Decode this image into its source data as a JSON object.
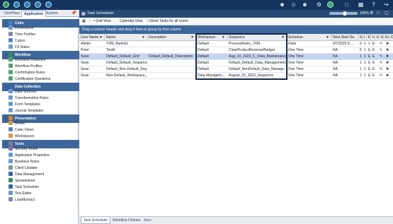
{
  "left_tabs": [
    "OnePlace",
    "Application",
    "System"
  ],
  "tree": [
    {
      "label": "Cube",
      "group": true
    },
    {
      "label": "Dimensions"
    },
    {
      "label": "Time Profiles"
    },
    {
      "label": "Cubes"
    },
    {
      "label": "FX Rates"
    },
    {
      "label": "Workflow",
      "group": true
    },
    {
      "label": "Workflow Channels"
    },
    {
      "label": "Workflow Profiles"
    },
    {
      "label": "Confirmation Rules"
    },
    {
      "label": "Certification Questions"
    },
    {
      "label": "Data Collection",
      "group": true
    },
    {
      "label": "Data Sources"
    },
    {
      "label": "Transformation Rules"
    },
    {
      "label": "Form Templates"
    },
    {
      "label": "Journal Templates"
    },
    {
      "label": "Presentation",
      "group": true
    },
    {
      "label": "Books"
    },
    {
      "label": "Cube Views"
    },
    {
      "label": "Workspaces"
    },
    {
      "label": "Tools",
      "group": true
    },
    {
      "label": "Security Roles"
    },
    {
      "label": "Application Properties"
    },
    {
      "label": "Business Rules"
    },
    {
      "label": "Client Updater"
    },
    {
      "label": "Data Management"
    },
    {
      "label": "Spreadsheet"
    },
    {
      "label": "Task Scheduler"
    },
    {
      "label": "Text Editor"
    },
    {
      "label": "Load/Extract"
    }
  ],
  "panel_title": "Task Scheduler",
  "zoom_label": "100%",
  "toolbar": {
    "grid_view": "Grid View",
    "calendar_view": "Calendar View",
    "show_all": "Show Tasks for all Users"
  },
  "group_hint": "Drag a column header and drop it here to group by that column",
  "columns": [
    "User Name",
    "Name",
    "Description",
    "Workspace",
    "Sequence",
    "Schedule",
    "Next Start Da",
    "N",
    "I",
    "E",
    "U",
    "E",
    "E",
    "Ex",
    "D"
  ],
  "rows": [
    {
      "user": "Admin",
      "name": "TXM_BankGL",
      "desc": "",
      "workspace": "Default",
      "sequence": "ProcessRules_TXM",
      "schedule": "Daily",
      "next": "9/7/2023 6:...",
      "flags": [
        "6",
        "1",
        "1",
        "E"
      ]
    },
    {
      "user": "Peter",
      "name": "TestA",
      "desc": "",
      "workspace": "Default",
      "sequence": "ClearProductRevenueBudget",
      "schedule": "One Time",
      "next": "NA",
      "flags": [
        "6",
        "1",
        "E",
        "E"
      ]
    },
    {
      "user": "Sean",
      "name": "Default_Default_Grid",
      "desc": "Default_Default_Description",
      "workspace": "Default",
      "sequence": "Aug_10_2023_C_Data_Maintenance...",
      "schedule": "One Time",
      "next": "NA",
      "flags": [
        "1",
        "1",
        "E",
        "E"
      ]
    },
    {
      "user": "Sean",
      "name": "Default_Default_Sequence",
      "desc": "",
      "workspace": "Default",
      "sequence": "Default_Default_Data_Management...",
      "schedule": "One Time",
      "next": "NA",
      "flags": [
        "1",
        "1",
        "E",
        "E"
      ]
    },
    {
      "user": "Sean",
      "name": "Default_Non-Default_Seq...",
      "desc": "",
      "workspace": "Default",
      "sequence": "Default_NonDefault_Data_Manage...",
      "schedule": "One Time",
      "next": "NA",
      "flags": [
        "1",
        "1",
        "E",
        "E"
      ]
    },
    {
      "user": "Sean",
      "name": "Non-Default_Workspace_...",
      "desc": "",
      "workspace": "Data Managem...",
      "sequence": "August_02_2023_Sequence",
      "schedule": "One Time",
      "next": "NA",
      "flags": [
        "1",
        "1",
        "E",
        "E"
      ]
    }
  ],
  "bottom_tabs": [
    "Task Scheduler",
    "Workflow Channe",
    "Xero"
  ],
  "colors": {
    "topbar": "#14345e",
    "title": "#254a74",
    "group": "#3e679b",
    "selected": "#c5d6ee",
    "highlight": "#15274a"
  }
}
